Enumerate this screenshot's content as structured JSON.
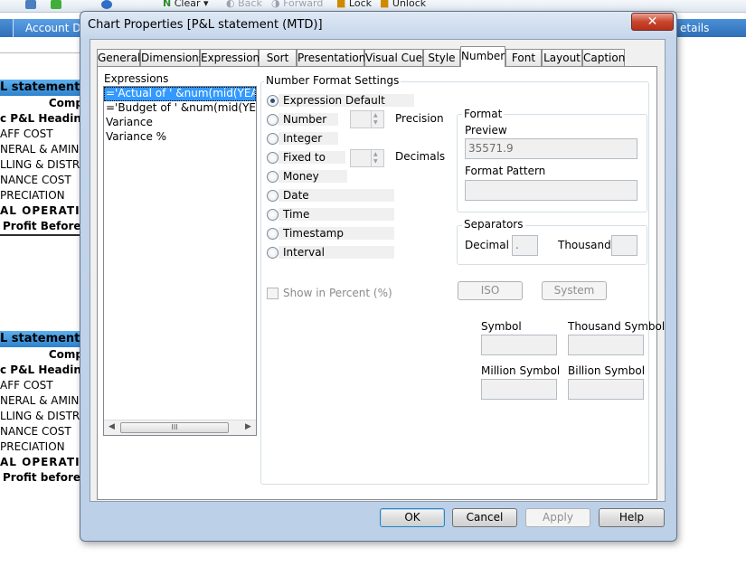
{
  "app": {
    "toolbar": {
      "clear_label": "Clear",
      "back_label": "Back",
      "forward_label": "Forward",
      "lock_label": "Lock",
      "unlock_label": "Unlock"
    },
    "tabs": {
      "account_tab": "Account Do",
      "details_tab": "etails"
    },
    "objects": [
      {
        "title": "L statement (",
        "header": "Comp",
        "rows": [
          "c P&L Heading",
          "AFF COST",
          "NERAL & AMIN",
          "LLING & DISTRI",
          "NANCE COST",
          "PRECIATION",
          "AL  OPERATIN",
          "Profit Before"
        ]
      },
      {
        "title": "L statement (",
        "header": "Comp",
        "rows": [
          "c P&L Heading",
          "AFF COST",
          "NERAL & AMIN",
          "LLING & DISTRI",
          "NANCE COST",
          "PRECIATION",
          "AL  OPERATIN",
          "Profit before"
        ]
      }
    ]
  },
  "dialog": {
    "title": "Chart Properties [P&L statement (MTD)]",
    "close_symbol": "✕",
    "tabs": [
      "General",
      "Dimensions",
      "Expressions",
      "Sort",
      "Presentation",
      "Visual Cues",
      "Style",
      "Number",
      "Font",
      "Layout",
      "Caption"
    ],
    "active_tab": "Number",
    "expressions": {
      "label": "Expressions",
      "items": [
        "='Actual of ' &num(mid(YEAR_MON",
        "='Budget of ' &num(mid(YEAR_MON",
        "Variance",
        "Variance %"
      ],
      "scroll_thumb_grip": "III"
    },
    "number_format": {
      "caption": "Number Format Settings",
      "options": [
        "Expression Default",
        "Number",
        "Integer",
        "Fixed to",
        "Money",
        "Date",
        "Time",
        "Timestamp",
        "Interval"
      ],
      "selected": "Expression Default",
      "precision_label": "Precision",
      "decimals_label": "Decimals",
      "show_in_percent_label": "Show in Percent (%)"
    },
    "format": {
      "caption": "Format",
      "preview_label": "Preview",
      "preview_value": "35571.9",
      "pattern_label": "Format Pattern",
      "pattern_value": ""
    },
    "separators": {
      "caption": "Separators",
      "decimal_label": "Decimal",
      "decimal_value": ".",
      "thousand_label": "Thousand",
      "thousand_value": ""
    },
    "iso_button": "ISO",
    "system_button": "System",
    "symbols": {
      "symbol_label": "Symbol",
      "thousand_symbol_label": "Thousand Symbol",
      "million_symbol_label": "Million Symbol",
      "billion_symbol_label": "Billion Symbol"
    },
    "buttons": {
      "ok": "OK",
      "cancel": "Cancel",
      "apply": "Apply",
      "help": "Help"
    }
  }
}
